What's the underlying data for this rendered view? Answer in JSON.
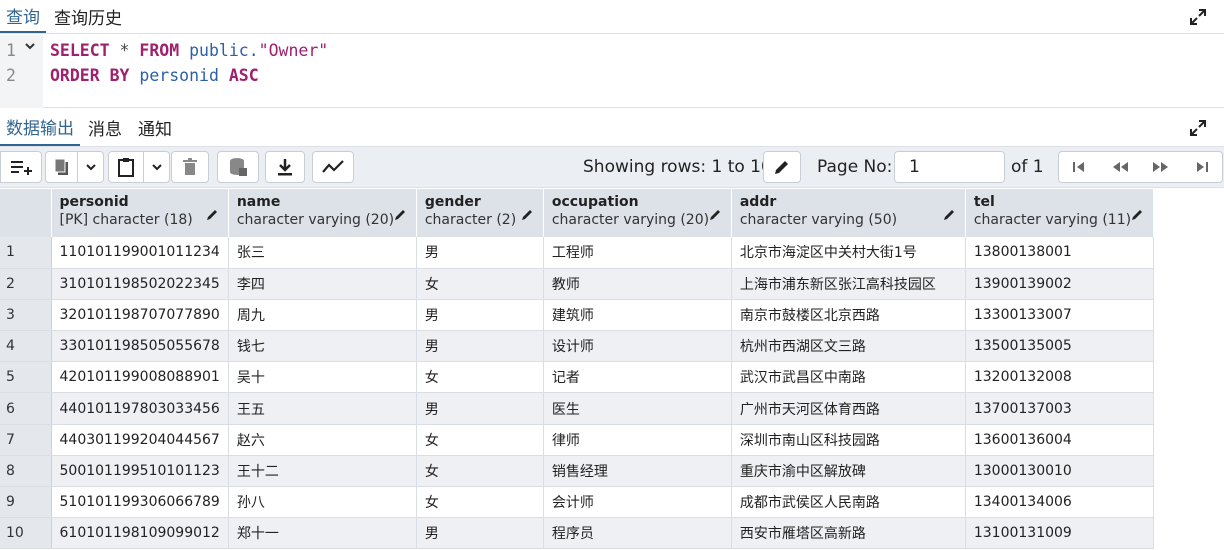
{
  "top_tabs": [
    {
      "label": "查询",
      "active": true
    },
    {
      "label": "查询历史",
      "active": false
    }
  ],
  "editor": {
    "line_numbers": [
      "1",
      "2"
    ],
    "line1": {
      "kw1": "SELECT",
      "op": " * ",
      "kw2": "FROM",
      "schema": " public.",
      "table": "\"Owner\""
    },
    "line2": {
      "kw1": "ORDER BY",
      "col": " personid",
      "kw2": " ASC"
    }
  },
  "result_tabs": [
    {
      "label": "数据输出",
      "active": true
    },
    {
      "label": "消息",
      "active": false
    },
    {
      "label": "通知",
      "active": false
    }
  ],
  "toolbar": {
    "showing_rows": "Showing rows: 1 to 10",
    "page_label": "Page No:",
    "page_value": "1",
    "of_label": "of 1"
  },
  "columns": [
    {
      "name": "personid",
      "type": "[PK] character (18)"
    },
    {
      "name": "name",
      "type": "character varying (20)"
    },
    {
      "name": "gender",
      "type": "character (2)"
    },
    {
      "name": "occupation",
      "type": "character varying (20)"
    },
    {
      "name": "addr",
      "type": "character varying (50)"
    },
    {
      "name": "tel",
      "type": "character varying (11)"
    }
  ],
  "rows": [
    [
      "1",
      "110101199001011234",
      "张三",
      "男",
      "工程师",
      "北京市海淀区中关村大街1号",
      "13800138001"
    ],
    [
      "2",
      "310101198502022345",
      "李四",
      "女",
      "教师",
      "上海市浦东新区张江高科技园区",
      "13900139002"
    ],
    [
      "3",
      "320101198707077890",
      "周九",
      "男",
      "建筑师",
      "南京市鼓楼区北京西路",
      "13300133007"
    ],
    [
      "4",
      "330101198505055678",
      "钱七",
      "男",
      "设计师",
      "杭州市西湖区文三路",
      "13500135005"
    ],
    [
      "5",
      "420101199008088901",
      "吴十",
      "女",
      "记者",
      "武汉市武昌区中南路",
      "13200132008"
    ],
    [
      "6",
      "440101197803033456",
      "王五",
      "男",
      "医生",
      "广州市天河区体育西路",
      "13700137003"
    ],
    [
      "7",
      "440301199204044567",
      "赵六",
      "女",
      "律师",
      "深圳市南山区科技园路",
      "13600136004"
    ],
    [
      "8",
      "500101199510101123",
      "王十二",
      "女",
      "销售经理",
      "重庆市渝中区解放碑",
      "13000130010"
    ],
    [
      "9",
      "510101199306066789",
      "孙八",
      "女",
      "会计师",
      "成都市武侯区人民南路",
      "13400134006"
    ],
    [
      "10",
      "610101198109099012",
      "郑十一",
      "男",
      "程序员",
      "西安市雁塔区高新路",
      "13100131009"
    ]
  ],
  "colors": {
    "accent": "#326690",
    "keyword": "#a0206f",
    "identifier": "#2c5fa8"
  }
}
